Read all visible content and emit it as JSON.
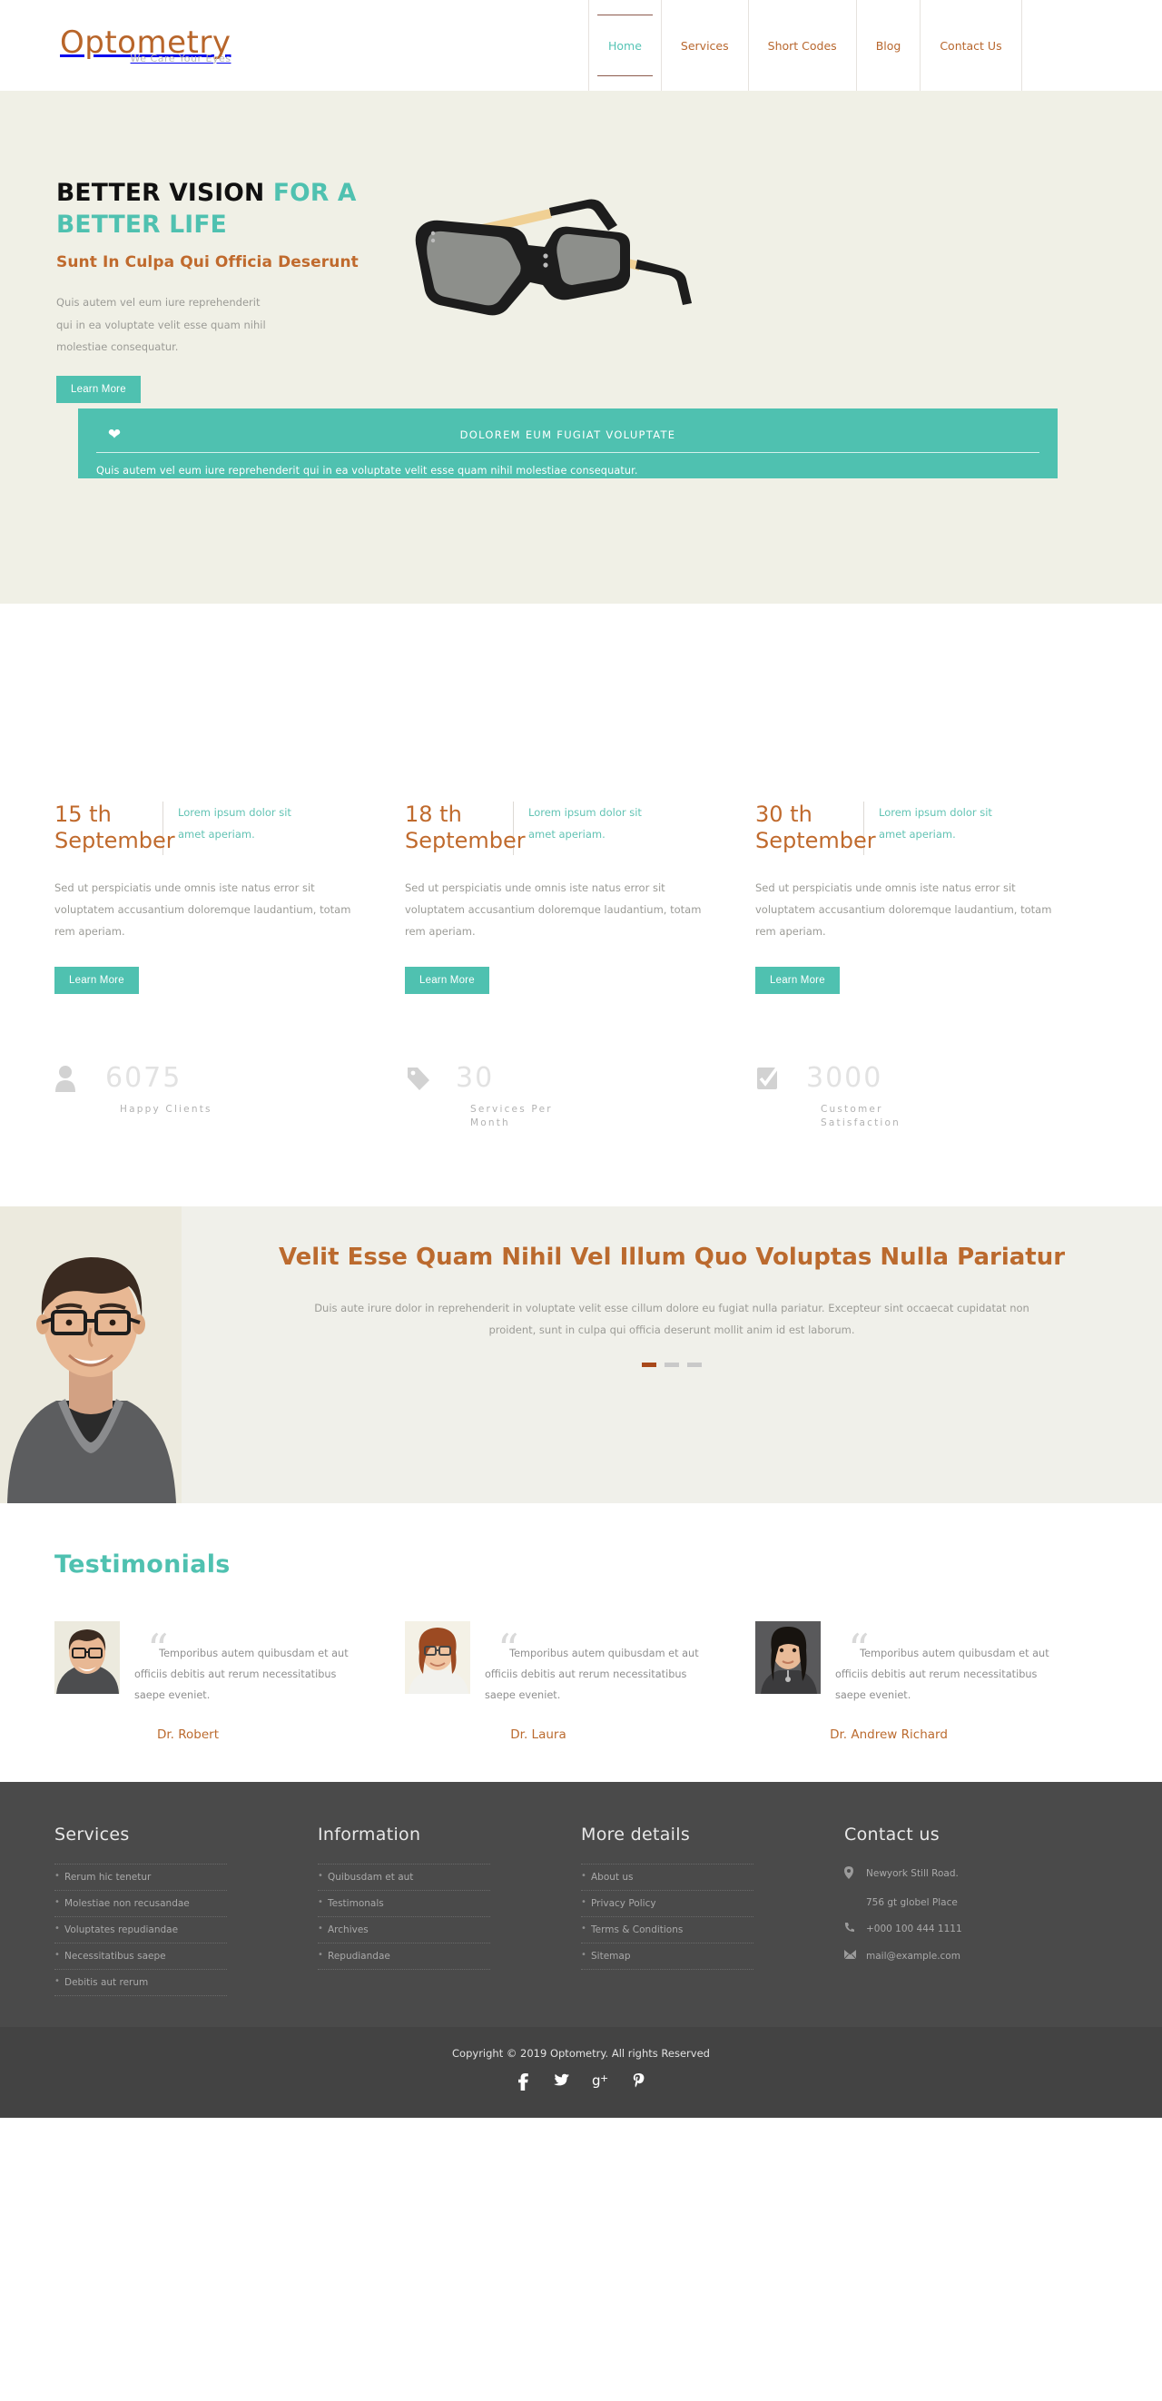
{
  "header": {
    "logo_name": "Optometry",
    "logo_tagline": "We Care Your Eyes",
    "nav": [
      {
        "label": "Home",
        "active": true
      },
      {
        "label": "Services",
        "active": false
      },
      {
        "label": "Short Codes",
        "active": false
      },
      {
        "label": "Blog",
        "active": false
      },
      {
        "label": "Contact Us",
        "active": false
      }
    ]
  },
  "hero": {
    "title_plain": "BETTER VISION ",
    "title_accent": "FOR A BETTER LIFE",
    "subtitle": "Sunt In Culpa Qui Officia Deserunt",
    "paragraph": "Quis autem vel eum iure reprehenderit qui in ea voluptate velit esse quam nihil molestiae consequatur.",
    "button": "Learn More",
    "image_alt": "black-eyeglasses-with-wooden-temples"
  },
  "banner": {
    "icon": "heart-icon",
    "title": "DOLOREM EUM FUGIAT VOLUPTATE",
    "description": "Quis autem vel eum iure reprehenderit qui in ea voluptate velit esse quam nihil molestiae consequatur."
  },
  "events": [
    {
      "day": "15 th",
      "month": "September",
      "sub": "Lorem ipsum dolor sit amet aperiam.",
      "body": "Sed ut perspiciatis unde omnis iste natus error sit voluptatem accusantium doloremque laudantium, totam rem aperiam.",
      "button": "Learn More"
    },
    {
      "day": "18 th",
      "month": "September",
      "sub": "Lorem ipsum dolor sit amet aperiam.",
      "body": "Sed ut perspiciatis unde omnis iste natus error sit voluptatem accusantium doloremque laudantium, totam rem aperiam.",
      "button": "Learn More"
    },
    {
      "day": "30 th",
      "month": "September",
      "sub": "Lorem ipsum dolor sit amet aperiam.",
      "body": "Sed ut perspiciatis unde omnis iste natus error sit voluptatem accusantium doloremque laudantium, totam rem aperiam.",
      "button": "Learn More"
    }
  ],
  "stats": [
    {
      "icon": "user-icon",
      "number": "6075",
      "label": "Happy Clients"
    },
    {
      "icon": "tag-icon",
      "number": "30",
      "label": "Services Per Month"
    },
    {
      "icon": "check-square-icon",
      "number": "3000",
      "label": "Customer Satisfaction"
    }
  ],
  "quote": {
    "heading": "Velit Esse Quam Nihil Vel Illum Quo Voluptas Nulla Pariatur",
    "paragraph": "Duis aute irure dolor in reprehenderit in voluptate velit esse cillum dolore eu fugiat nulla pariatur. Excepteur sint occaecat cupidatat non proident, sunt in culpa qui officia deserunt mollit anim id est laborum.",
    "dots": 3,
    "active_dot": 0,
    "photo_alt": "smiling-man-with-glasses"
  },
  "testimonials": {
    "title": "Testimonials",
    "items": [
      {
        "text": "Temporibus autem quibusdam et aut officiis debitis aut rerum necessitatibus saepe eveniet.",
        "name": "Dr. Robert",
        "photo_alt": "man-with-glasses-smiling"
      },
      {
        "text": "Temporibus autem quibusdam et aut officiis debitis aut rerum necessitatibus saepe eveniet.",
        "name": "Dr. Laura",
        "photo_alt": "red-haired-woman-with-glasses"
      },
      {
        "text": "Temporibus autem quibusdam et aut officiis debitis aut rerum necessitatibus saepe eveniet.",
        "name": "Dr. Andrew Richard",
        "photo_alt": "dark-haired-woman"
      }
    ]
  },
  "footer": {
    "columns": [
      {
        "title": "Services",
        "items": [
          "Rerum hic tenetur",
          "Molestiae non recusandae",
          "Voluptates repudiandae",
          "Necessitatibus saepe",
          "Debitis aut rerum"
        ]
      },
      {
        "title": "Information",
        "items": [
          "Quibusdam et aut",
          "Testimonals",
          "Archives",
          "Repudiandae"
        ]
      },
      {
        "title": "More details",
        "items": [
          "About us",
          "Privacy Policy",
          "Terms & Conditions",
          "Sitemap"
        ]
      }
    ],
    "contact": {
      "title": "Contact us",
      "address_line1": "Newyork Still Road.",
      "address_line2": "756 gt globel Place",
      "phone": "+000 100 444 1111",
      "email": "mail@example.com"
    },
    "copyright": "Copyright © 2019 Optometry. All rights Reserved",
    "social": [
      {
        "name": "facebook-icon",
        "glyph": "f"
      },
      {
        "name": "twitter-icon",
        "glyph": "🐦"
      },
      {
        "name": "googleplus-icon",
        "glyph": "g+"
      },
      {
        "name": "pinterest-icon",
        "glyph": "𝓟"
      }
    ]
  },
  "colors": {
    "brand_brown": "#b8652a",
    "accent_teal": "#4fc1b0",
    "hero_bg": "#f0f0e6",
    "footer_bg": "#4a4a4a",
    "copy_bg": "#434343"
  }
}
